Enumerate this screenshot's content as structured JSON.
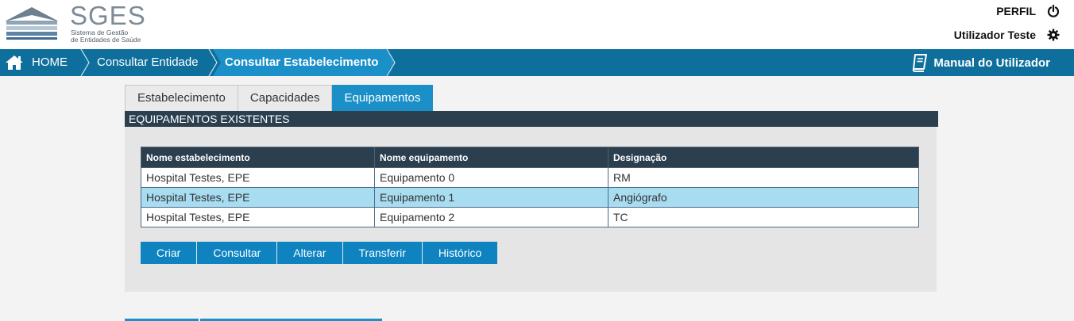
{
  "app": {
    "logo_text": "SGES",
    "logo_subtitle_line1": "Sistema de Gestão",
    "logo_subtitle_line2": "de Entidades de Saúde"
  },
  "header": {
    "perfil_label": "PERFIL",
    "user_name": "Utilizador Teste",
    "icons": {
      "logout": "power-icon",
      "settings": "gear-icon"
    }
  },
  "breadcrumb": {
    "home": "HOME",
    "items": [
      "Consultar Entidade",
      "Consultar Estabelecimento"
    ]
  },
  "manual_label": "Manual do Utilizador",
  "tabs": [
    {
      "label": "Estabelecimento",
      "active": false
    },
    {
      "label": "Capacidades",
      "active": false
    },
    {
      "label": "Equipamentos",
      "active": true
    }
  ],
  "section_title": "EQUIPAMENTOS EXISTENTES",
  "table": {
    "columns": [
      "Nome estabelecimento",
      "Nome equipamento",
      "Designação"
    ],
    "rows": [
      {
        "cells": [
          "Hospital Testes, EPE",
          "Equipamento 0",
          "RM"
        ],
        "selected": false
      },
      {
        "cells": [
          "Hospital Testes, EPE",
          "Equipamento 1",
          "Angiógrafo"
        ],
        "selected": true
      },
      {
        "cells": [
          "Hospital Testes, EPE",
          "Equipamento 2",
          "TC"
        ],
        "selected": false
      }
    ]
  },
  "actions": [
    "Criar",
    "Consultar",
    "Alterar",
    "Transferir",
    "Histórico"
  ],
  "colors": {
    "navbar": "#0f6f9c",
    "accent": "#1a8fc8",
    "table_header": "#2b3f4f",
    "selected_row": "#a8dcf1",
    "button": "#0f83c0"
  }
}
